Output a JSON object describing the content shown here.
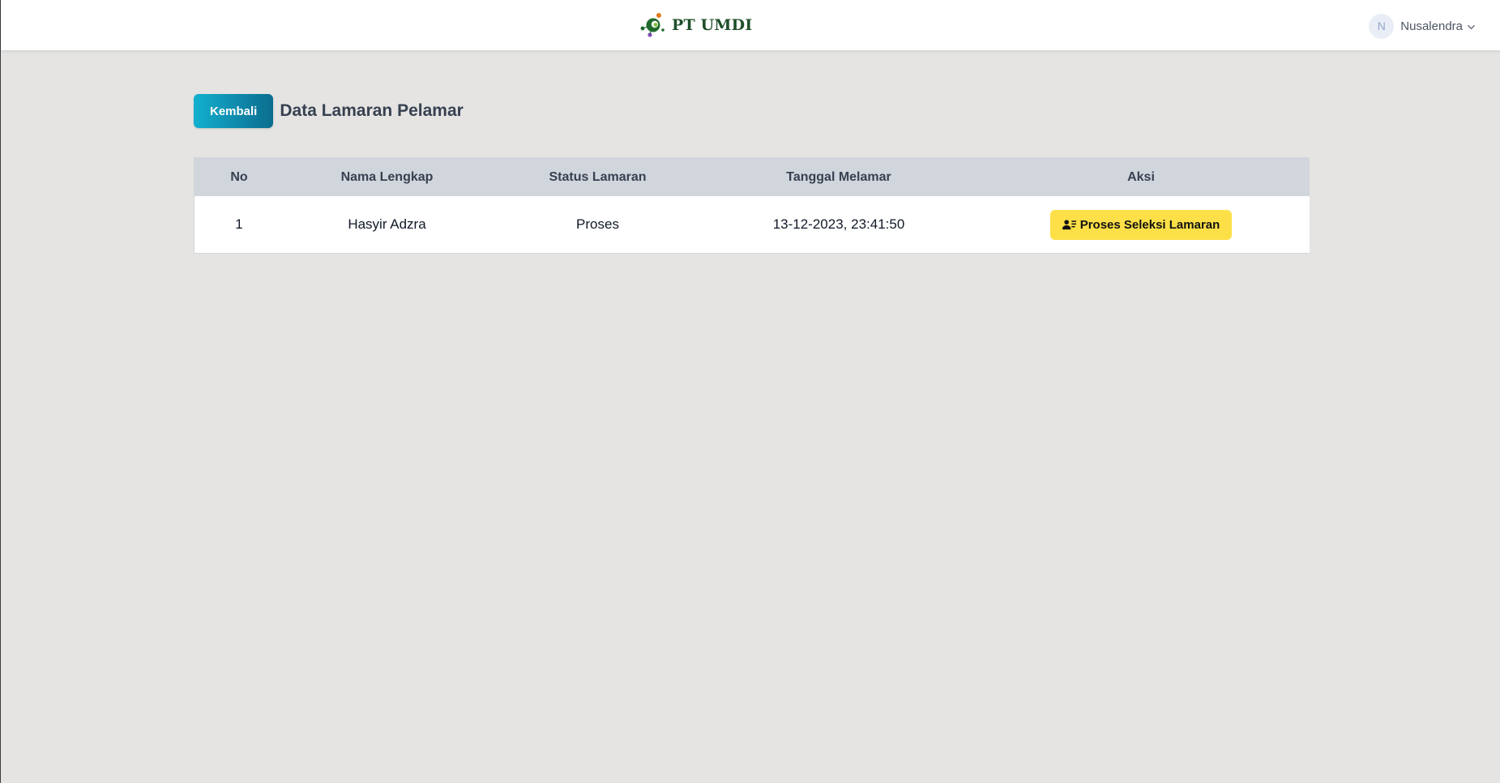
{
  "header": {
    "brand_name": "PT UMDI",
    "logo_icon": "company-logo-icon",
    "user": {
      "initial": "N",
      "name": "Nusalendra",
      "dropdown_icon": "chevron-down-icon"
    }
  },
  "page": {
    "back_label": "Kembali",
    "title": "Data Lamaran Pelamar"
  },
  "table": {
    "columns": [
      "No",
      "Nama Lengkap",
      "Status Lamaran",
      "Tanggal Melamar",
      "Aksi"
    ],
    "rows": [
      {
        "no": "1",
        "nama": "Hasyir Adzra",
        "status": "Proses",
        "tanggal": "13-12-2023, 23:41:50",
        "action_label": "Proses Seleksi Lamaran",
        "action_icon": "user-list-icon"
      }
    ]
  },
  "colors": {
    "background": "#e5e4e2",
    "header_bg": "#ffffff",
    "back_button": "#0e86a8",
    "table_head": "#d1d5dc",
    "action_button": "#fde047",
    "brand_text": "#1f4f2a"
  }
}
